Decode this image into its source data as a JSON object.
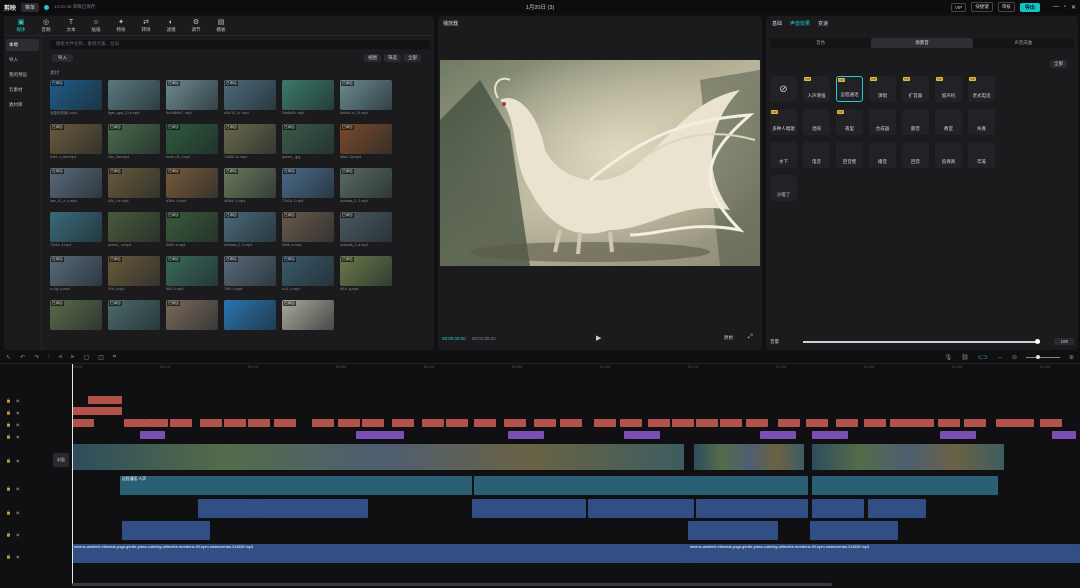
{
  "app": {
    "logo": "剪映",
    "menu": "菜单",
    "autosave": "14:21:45 草稿已保存",
    "date": "1月20日 (3)",
    "plan_label": "VIP",
    "shortcut_label": "快捷键",
    "upgrade_label": "审核",
    "export_label": "导出"
  },
  "toolbar": {
    "items": [
      {
        "icon": "media-icon",
        "label": "媒体"
      },
      {
        "icon": "audio-icon",
        "label": "音频"
      },
      {
        "icon": "text-icon",
        "label": "文本"
      },
      {
        "icon": "sticker-icon",
        "label": "贴纸"
      },
      {
        "icon": "effects-icon",
        "label": "特效"
      },
      {
        "icon": "transition-icon",
        "label": "转场"
      },
      {
        "icon": "filter-icon",
        "label": "滤镜"
      },
      {
        "icon": "adjust-icon",
        "label": "调节"
      },
      {
        "icon": "template-icon",
        "label": "模板"
      }
    ]
  },
  "leftnav": {
    "items": [
      "本地",
      "导入",
      "我的预设",
      "云素材",
      "素材库"
    ]
  },
  "media": {
    "search_placeholder": "搜索文件名称、素材元素、台词",
    "import_label": "导入",
    "view_label": "视图",
    "filter_label": "筛选",
    "sort_label": "全部",
    "section": "素材",
    "items": [
      {
        "cap": "深蓝色背景1.mp4",
        "tag": "已添加",
        "color": "#1f5c8a"
      },
      {
        "cap": "tiger_qyxj_13 b.mp4",
        "tag": "",
        "color": "#5a7a80"
      },
      {
        "cap": "8c1a3b5c7..mp4",
        "tag": "已添加",
        "color": "#6e8a90"
      },
      {
        "cap": "a3c72f_1c..mp4",
        "tag": "已添加",
        "color": "#4d6a7a"
      },
      {
        "cap": "0ba5e2d..mp4",
        "tag": "",
        "color": "#3c7a6a"
      },
      {
        "cap": "Aw5c4..rt_14.mp4",
        "tag": "已添加",
        "color": "#6a8a90"
      },
      {
        "cap": "b4e1..c_tert.mp4",
        "tag": "已添加",
        "color": "#6a5a3a"
      },
      {
        "cap": "1bc_7ad.mp4",
        "tag": "已添加",
        "color": "#4a6a4a"
      },
      {
        "cap": "bc9a..04_r.mp4",
        "tag": "已添加",
        "color": "#2f5a3c"
      },
      {
        "cap": "7cd35..4c.mp4",
        "tag": "已添加",
        "color": "#6a6a4a"
      },
      {
        "cap": "queen_..jpg",
        "tag": "已添加",
        "color": "#3c5a4a"
      },
      {
        "cap": "d5cb..2a.mp4",
        "tag": "已添加",
        "color": "#7a4a2a"
      },
      {
        "cap": "laer_11_e..c.mp4",
        "tag": "已添加",
        "color": "#5a6a7a"
      },
      {
        "cap": "b3d_r1e.mp4",
        "tag": "已添加",
        "color": "#6a5a3a"
      },
      {
        "cap": "a3f4c..4.mp4",
        "tag": "已添加",
        "color": "#7a5a3a"
      },
      {
        "cap": "4b3e4..4.mp4",
        "tag": "已添加",
        "color": "#6a7a5a"
      },
      {
        "cap": "72e1d..2.mp4",
        "tag": "已添加",
        "color": "#4a6a8a"
      },
      {
        "cap": "Animals_2..2.mp4",
        "tag": "已添加",
        "color": "#5a6a60"
      },
      {
        "cap": "73c1e..4.mp4",
        "tag": "",
        "color": "#3a6a7a"
      },
      {
        "cap": "queen_..a.mp4",
        "tag": "",
        "color": "#4a5a3a"
      },
      {
        "cap": "5e5b..e.mp4",
        "tag": "已添加",
        "color": "#3a5a3a"
      },
      {
        "cap": "Animals_2..2.mp4",
        "tag": "已添加",
        "color": "#4a6a7a"
      },
      {
        "cap": "5e5b..e.mp4",
        "tag": "已添加",
        "color": "#6a5a4a"
      },
      {
        "cap": "Animals_2..a.mp4",
        "tag": "已添加",
        "color": "#4a5a60"
      },
      {
        "cap": "a.r1jk..p.mp4",
        "tag": "已添加",
        "color": "#5a6a7a"
      },
      {
        "cap": "91d..j.mp4",
        "tag": "已添加",
        "color": "#6a5a3a"
      },
      {
        "cap": "8b3..4.mp4",
        "tag": "已添加",
        "color": "#3a6a5a"
      },
      {
        "cap": "7bf2..4.mp4",
        "tag": "已添加",
        "color": "#5a6a7a"
      },
      {
        "cap": "a.c1..c.mp4",
        "tag": "已添加",
        "color": "#3a5a6a"
      },
      {
        "cap": "9f16..g.mp4",
        "tag": "已添加",
        "color": "#6a7a4a"
      },
      {
        "cap": "",
        "tag": "已添加",
        "color": "#5a6a4a"
      },
      {
        "cap": "",
        "tag": "已添加",
        "color": "#4a6a6a"
      },
      {
        "cap": "",
        "tag": "已添加",
        "color": "#7a6a5a"
      },
      {
        "cap": "",
        "tag": "",
        "color": "#2a74b0"
      },
      {
        "cap": "",
        "tag": "已添加",
        "color": "#aaa89a"
      }
    ]
  },
  "player": {
    "title": "播放器",
    "time_current": "00:00:00:00",
    "time_total": "00:01:00:22",
    "ratio_label": "原始"
  },
  "props": {
    "tabs": [
      "基础",
      "声音效果",
      "变速"
    ],
    "active_tab": 1,
    "subtabs": [
      "音色",
      "场景音",
      "声音成曲"
    ],
    "active_subtab": 1,
    "sort_label": "全部",
    "effects": [
      {
        "label": "",
        "vip": false,
        "icon": "none-icon"
      },
      {
        "label": "人声增强",
        "vip": true
      },
      {
        "label": "远程通话",
        "vip": true,
        "sel": true
      },
      {
        "label": "演唱",
        "vip": true
      },
      {
        "label": "扩音器",
        "vip": true
      },
      {
        "label": "留声机",
        "vip": true
      },
      {
        "label": "老式电话",
        "vip": true
      },
      {
        "label": "多钟人唱歌",
        "vip": true
      },
      {
        "label": "混响",
        "vip": false
      },
      {
        "label": "夜里",
        "vip": true
      },
      {
        "label": "合成器",
        "vip": false
      },
      {
        "label": "颤音",
        "vip": false
      },
      {
        "label": "教室",
        "vip": false
      },
      {
        "label": "失真",
        "vip": false
      },
      {
        "label": "水下",
        "vip": false
      },
      {
        "label": "电音",
        "vip": false
      },
      {
        "label": "回音壁",
        "vip": false
      },
      {
        "label": "播音",
        "vip": false
      },
      {
        "label": "回音",
        "vip": false
      },
      {
        "label": "低保真",
        "vip": false
      },
      {
        "label": "牢笼",
        "vip": false
      },
      {
        "label": "沙哑了",
        "vip": false
      }
    ],
    "volume_label": "音量",
    "volume_value": "100"
  },
  "timeline": {
    "ruler": [
      "00:00",
      "00:10",
      "00:20",
      "00:30",
      "00:40",
      "00:50",
      "01:00",
      "01:10",
      "01:20",
      "01:30",
      "01:40",
      "01:50"
    ],
    "cover_label": "封面",
    "music_name": "serene-ambient-ethereal-yoga-gentle-piano-calming-reflective-emotions-90-bpm-instrumental-314539.mp3",
    "clip_label": "远程通话·人声"
  }
}
